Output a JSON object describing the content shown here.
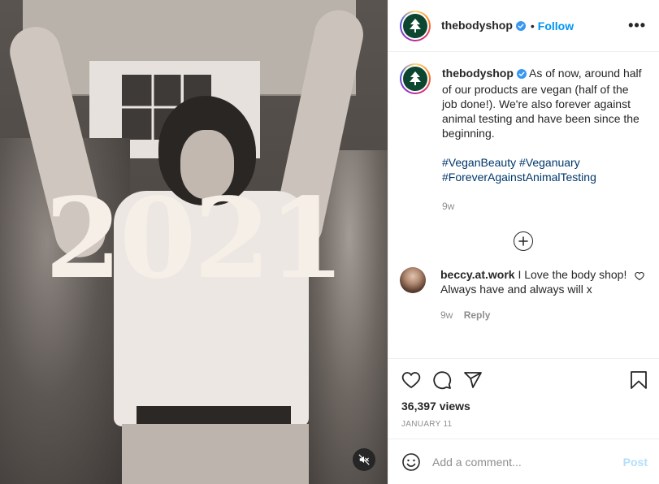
{
  "media": {
    "overlay_text": "2021"
  },
  "header": {
    "username": "thebodyshop",
    "separator": "•",
    "follow_label": "Follow",
    "more_label": "•••"
  },
  "caption": {
    "username": "thebodyshop",
    "text": "As of now, around half of our products are vegan (half of the job done!). We're also forever against animal testing and have been since the beginning.",
    "hashtags": [
      "#VeganBeauty",
      "#Veganuary",
      "#ForeverAgainstAnimalTesting"
    ],
    "time": "9w"
  },
  "comments": [
    {
      "username": "beccy.at.work",
      "text": "I Love the body shop! Always have and always will x",
      "time": "9w",
      "reply_label": "Reply"
    }
  ],
  "stats": {
    "views": "36,397 views",
    "date": "January 11"
  },
  "comment_box": {
    "placeholder": "Add a comment...",
    "post_label": "Post"
  },
  "colors": {
    "accent": "#0095f6",
    "brand_green": "#0d4630",
    "hashtag": "#00376b",
    "muted": "#8e8e8e",
    "post_disabled": "#b2dffc"
  },
  "icons": [
    "volume-off-icon",
    "verified-badge-icon",
    "more-options-icon",
    "load-more-icon",
    "heart-icon",
    "comment-icon",
    "share-icon",
    "bookmark-icon",
    "emoji-icon"
  ]
}
